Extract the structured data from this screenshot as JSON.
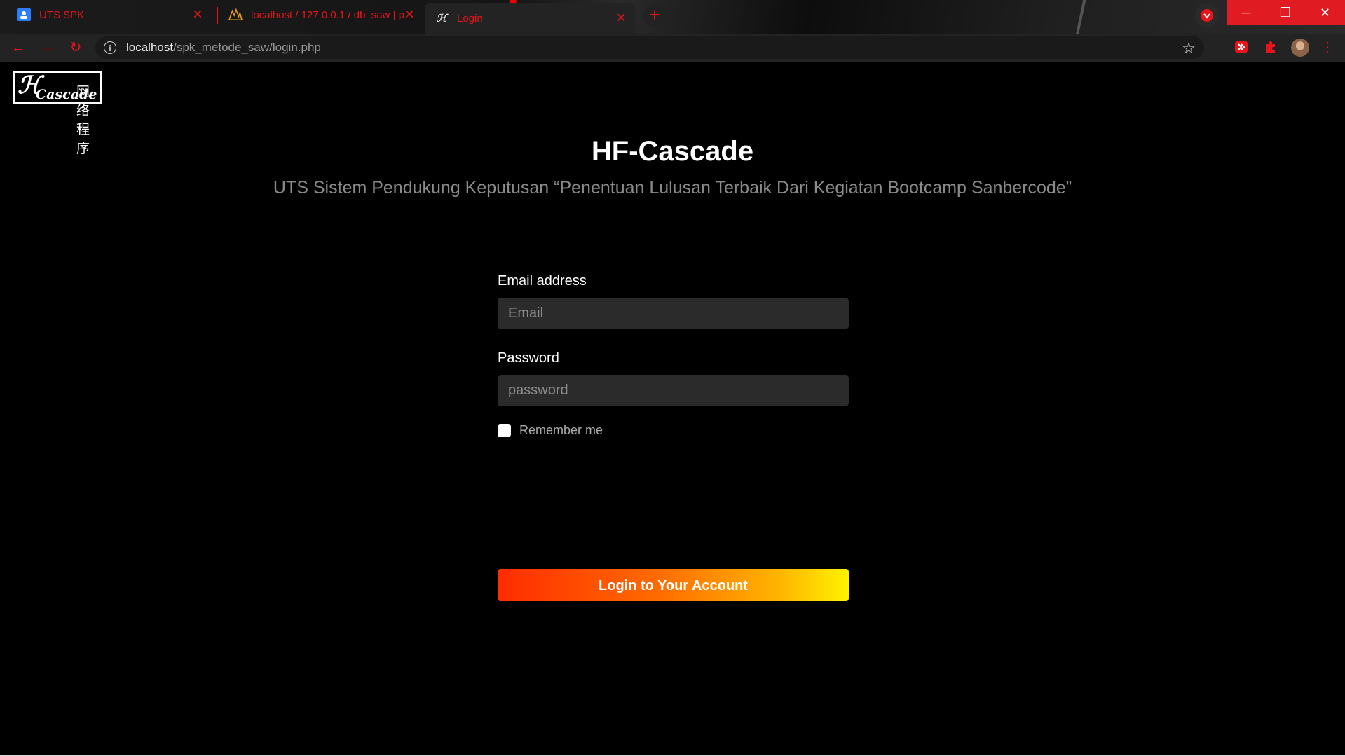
{
  "browser": {
    "tabs": [
      {
        "title": "UTS SPK",
        "favicon": "google-classroom-icon"
      },
      {
        "title": "localhost / 127.0.0.1 / db_saw | p",
        "favicon": "phpmyadmin-icon"
      },
      {
        "title": "Login",
        "favicon": "hf-cascade-icon",
        "active": true
      }
    ],
    "new_tab_label": "+",
    "url_host": "localhost",
    "url_path": "/spk_metode_saw/login.php",
    "accent_color": "#e8141b"
  },
  "page": {
    "logo_text_latin": "HF Cascade",
    "logo_text_cn": "网络程序",
    "title": "HF-Cascade",
    "subtitle": "UTS Sistem Pendukung Keputusan “Penentuan Lulusan Terbaik Dari Kegiatan Bootcamp Sanbercode”",
    "form": {
      "email_label": "Email address",
      "email_placeholder": "Email",
      "password_label": "Password",
      "password_placeholder": "password",
      "remember_label": "Remember me",
      "submit_label": "Login to Your Account"
    }
  }
}
